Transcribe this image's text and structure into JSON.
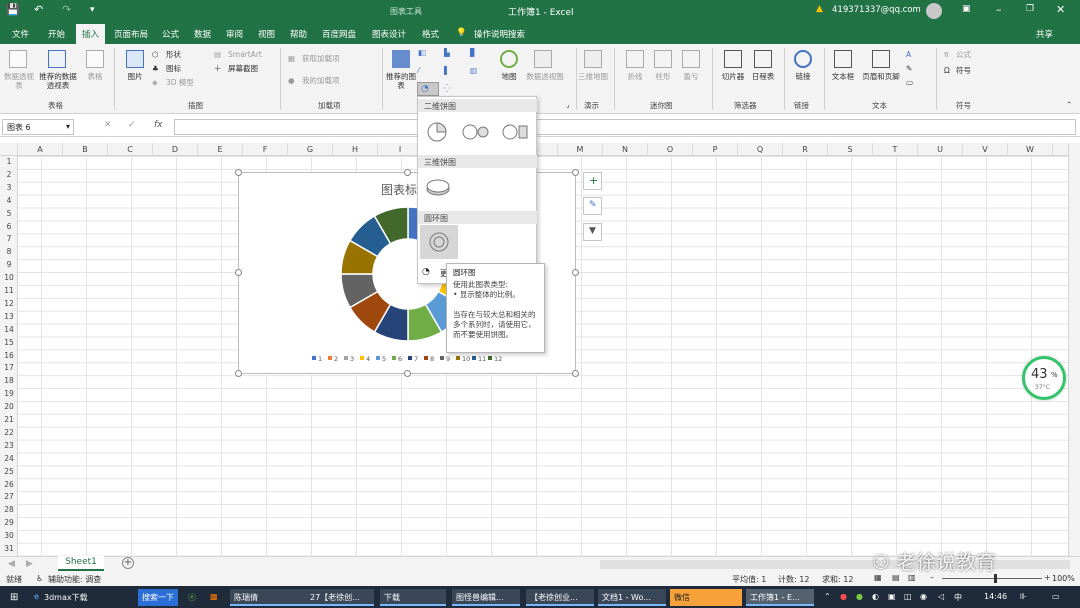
{
  "titlebar": {
    "tools_title": "图表工具",
    "doc_title": "工作簿1  -  Excel",
    "user": "419371337@qq.com"
  },
  "tabs": [
    "文件",
    "开始",
    "插入",
    "页面布局",
    "公式",
    "数据",
    "审阅",
    "视图",
    "帮助",
    "百度网盘",
    "图表设计",
    "格式"
  ],
  "active_tab": "插入",
  "tell_me": "操作说明搜索",
  "share": "共享",
  "ribbon": {
    "pivot": "数据透视表",
    "rec_pivot": "推荐的数据透视表",
    "table": "表格",
    "group_tables": "表格",
    "picture": "图片",
    "shapes": "形状",
    "icons": "图标",
    "models3d": "3D 模型",
    "smartart": "SmartArt",
    "screenshot": "屏幕截图",
    "group_illus": "插图",
    "get_addins": "获取加载项",
    "my_addins": "我的加载项",
    "group_addins": "加载项",
    "rec_charts": "推荐的图表",
    "maps": "地图",
    "pivot_chart": "数据透视图",
    "group_charts": "",
    "map3d": "三维地图",
    "group_tours": "演示",
    "spark_line": "折线",
    "spark_col": "柱形",
    "spark_wl": "盈亏",
    "group_spark": "迷你图",
    "slicer": "切片器",
    "timeline": "日程表",
    "group_filters": "筛选器",
    "link": "链接",
    "group_links": "链接",
    "textbox": "文本框",
    "headerfooter": "页眉和页脚",
    "group_text": "文本",
    "equation": "公式",
    "symbol": "符号",
    "group_symbols": "符号"
  },
  "namebox": "图表 6",
  "fx": "fx",
  "columns": [
    "A",
    "B",
    "C",
    "D",
    "E",
    "F",
    "G",
    "H",
    "I",
    "J",
    "K",
    "L",
    "M",
    "N",
    "O",
    "P",
    "Q",
    "R",
    "S",
    "T",
    "U",
    "V",
    "W"
  ],
  "rows": [
    "1",
    "2",
    "3",
    "4",
    "5",
    "6",
    "7",
    "8",
    "9",
    "10",
    "11",
    "12",
    "13",
    "14",
    "15",
    "16",
    "17",
    "18",
    "19",
    "20",
    "21",
    "22",
    "23",
    "24",
    "25",
    "26",
    "27",
    "28",
    "29",
    "30",
    "31"
  ],
  "chart": {
    "title": "图表标题",
    "legend": [
      "1",
      "2",
      "3",
      "4",
      "5",
      "6",
      "7",
      "8",
      "9",
      "10",
      "11",
      "12"
    ],
    "colors": [
      "#4472c4",
      "#ed7d31",
      "#a5a5a5",
      "#ffc000",
      "#5b9bd5",
      "#70ad47",
      "#264478",
      "#9e480e",
      "#636363",
      "#997300",
      "#255e91",
      "#43682b"
    ]
  },
  "chart_data": {
    "type": "pie",
    "title": "图表标题",
    "categories": [
      "1",
      "2",
      "3",
      "4",
      "5",
      "6",
      "7",
      "8",
      "9",
      "10",
      "11",
      "12"
    ],
    "values": [
      1,
      1,
      1,
      1,
      1,
      1,
      1,
      1,
      1,
      1,
      1,
      1
    ]
  },
  "dropdown": {
    "sec2d": "二维饼图",
    "sec3d": "三维饼图",
    "secdonut": "圆环图",
    "more": "更多饼图(M)..."
  },
  "tooltip": {
    "title": "圆环图",
    "line1": "使用此图表类型:",
    "line2": "• 显示整体的比例。",
    "line3": "当存在与较大总和相关的多个系列时，请使用它，而不要使用饼图。"
  },
  "sheet": {
    "name": "Sheet1"
  },
  "status": {
    "ready": "就绪",
    "accessibility": "辅助功能: 调查",
    "avg": "平均值: 1",
    "count": "计数: 12",
    "sum": "求和: 12",
    "zoom": "100%"
  },
  "watermark": "老徐说教育",
  "widget": {
    "pct": "43",
    "unit": "%",
    "temp": "37°C"
  },
  "taskbar": {
    "items": [
      "3dmax下载",
      "搜索一下",
      "陈瑞倩",
      "27【老徐创...",
      "下载",
      "图怪兽编辑...",
      "【老徐创业...",
      "文档1 - Wo...",
      "微信",
      "工作簿1 - E..."
    ],
    "time": "14:46"
  }
}
